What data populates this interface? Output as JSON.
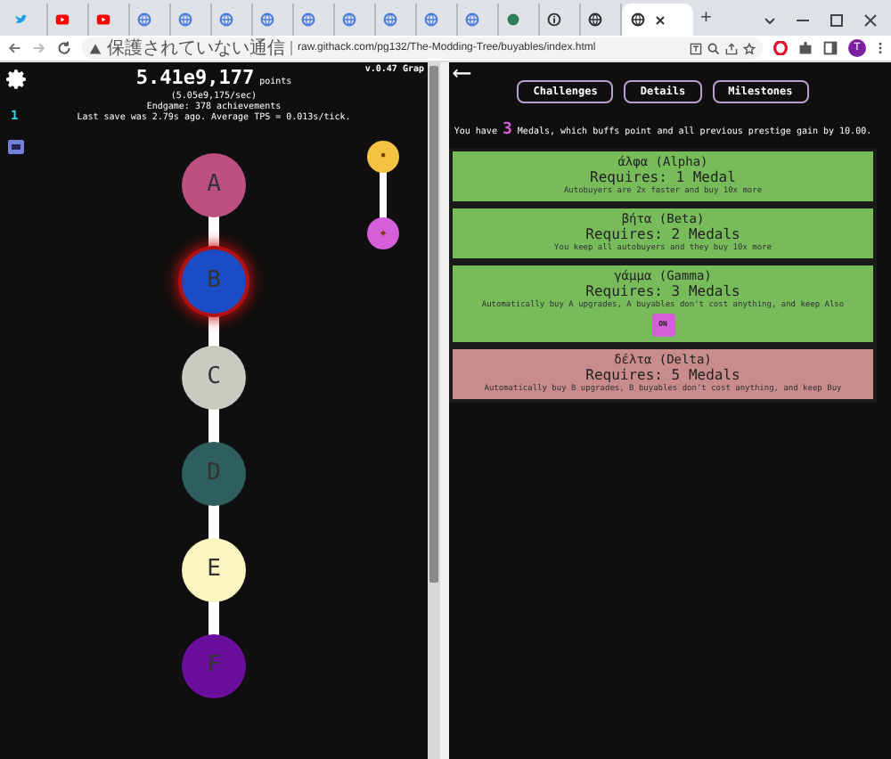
{
  "browser": {
    "tabs": [
      {
        "kind": "bird",
        "color": "#1d9bf0",
        "selected": false
      },
      {
        "kind": "play",
        "color": "#ff0000",
        "selected": false
      },
      {
        "kind": "play",
        "color": "#ff0000",
        "selected": false
      },
      {
        "kind": "globe",
        "color": "#4a7ddc",
        "selected": false
      },
      {
        "kind": "globe",
        "color": "#4a7ddc",
        "selected": false
      },
      {
        "kind": "globe",
        "color": "#4a7ddc",
        "selected": false
      },
      {
        "kind": "globe",
        "color": "#4a7ddc",
        "selected": false
      },
      {
        "kind": "globe",
        "color": "#4a7ddc",
        "selected": false
      },
      {
        "kind": "globe",
        "color": "#4a7ddc",
        "selected": false
      },
      {
        "kind": "globe",
        "color": "#4a7ddc",
        "selected": false
      },
      {
        "kind": "globe",
        "color": "#4a7ddc",
        "selected": false
      },
      {
        "kind": "globe",
        "color": "#4a7ddc",
        "selected": false
      },
      {
        "kind": "dot",
        "color": "#2e7d5b",
        "selected": false
      },
      {
        "kind": "info",
        "color": "#333333",
        "selected": false
      },
      {
        "kind": "globe",
        "color": "#333333",
        "selected": false
      },
      {
        "kind": "globe",
        "color": "#333333",
        "selected": true
      }
    ],
    "new_tab": "+",
    "security": "保護されていない通信",
    "url": "raw.githack.com/pg132/The-Modding-Tree/buyables/index.html",
    "avatar": "T"
  },
  "game": {
    "version": "v.0.47 Grap",
    "points": "5.41e9,177",
    "points_unit": "points",
    "rate": "(5.05e9,175/sec)",
    "endgame": "Endgame: 378 achievements",
    "save_info": "Last save was 2.79s ago. Average TPS = 0.013s/tick.",
    "side_number": "1",
    "nodes": [
      {
        "label": "A",
        "color": "#bd4f80",
        "selected": false
      },
      {
        "label": "B",
        "color": "#1a4cc6",
        "selected": true
      },
      {
        "label": "C",
        "color": "#c9cac2",
        "selected": false
      },
      {
        "label": "D",
        "color": "#2e5e5e",
        "selected": false
      },
      {
        "label": "E",
        "color": "#fcf5bf",
        "selected": false
      },
      {
        "label": "F",
        "color": "#6a0e9e",
        "selected": false
      }
    ],
    "side_nodes": [
      {
        "symbol": "•",
        "color": "#f5c243"
      },
      {
        "symbol": "✦",
        "color": "#d55fd8"
      }
    ]
  },
  "panel": {
    "back": "⟵",
    "tabs": [
      {
        "label": "Challenges"
      },
      {
        "label": "Details"
      },
      {
        "label": "Milestones"
      }
    ],
    "summary": {
      "prefix": "You have",
      "count": "3",
      "suffix": "Medals, which buffs point and all previous prestige gain by 10.00."
    },
    "milestones": [
      {
        "title": "άλφα (Alpha)",
        "requirement": "Requires: 1 Medal",
        "effect": "Autobuyers are 2x faster and buy 10x more",
        "done": true
      },
      {
        "title": "βήτα (Beta)",
        "requirement": "Requires: 2 Medals",
        "effect": "You keep all autobuyers and they buy 10x more",
        "done": true
      },
      {
        "title": "γάμμα (Gamma)",
        "requirement": "Requires: 3 Medals",
        "effect": "Automatically buy A upgrades, A buyables don't cost anything, and keep Also",
        "done": true,
        "toggle": "ON"
      },
      {
        "title": "δέλτα (Delta)",
        "requirement": "Requires: 5 Medals",
        "effect": "Automatically buy B upgrades, B buyables don't cost anything, and keep Buy",
        "done": false
      }
    ]
  }
}
